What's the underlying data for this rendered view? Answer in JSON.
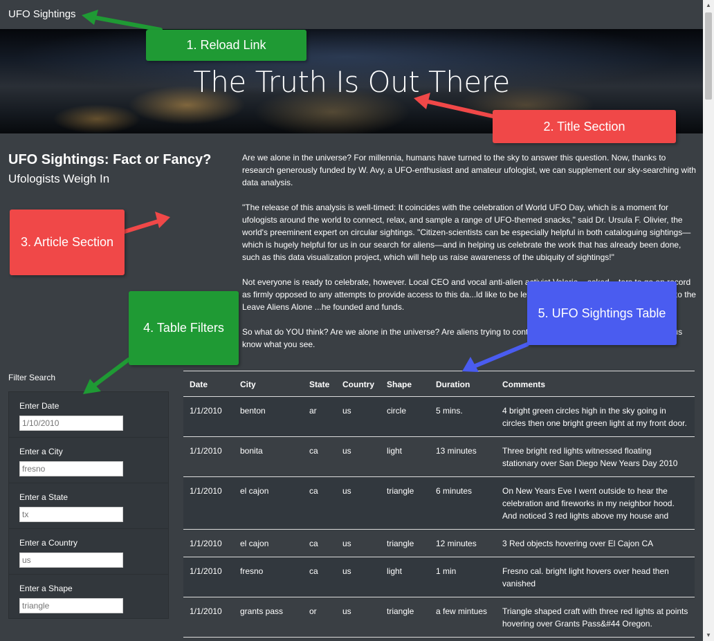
{
  "navbar": {
    "brand": "UFO Sightings"
  },
  "hero": {
    "title": "The Truth Is Out There"
  },
  "article": {
    "title": "UFO Sightings: Fact or Fancy?",
    "subtitle": "Ufologists Weigh In",
    "paragraphs": [
      "Are we alone in the universe? For millennia, humans have turned to the sky to answer this question. Now, thanks to research generously funded by W. Avy, a UFO-enthusiast and amateur ufologist, we can supplement our sky-searching with data analysis.",
      "\"The release of this analysis is well-timed: It coincides with the celebration of World UFO Day, which is a moment for ufologists around the world to connect, relax, and sample a range of UFO-themed snacks,\" said Dr. Ursula F. Olivier, the world's preeminent expert on circular sightings. \"Citizen-scientists can be especially helpful in both cataloguing sightings—which is hugely helpful for us in our search for aliens—and in helping us celebrate the work that has already been done, such as this data visualization project, which will help us raise awareness of the ubiquity of sightings!\"",
      "Not everyone is ready to celebrate, however. Local CEO and vocal anti-alien activist Valerie... asked ...ters to go on record as firmly opposed to any attempts to provide access to this da...ld like to be left alone,\" she stated, before directing us to the Leave Aliens Alone ...he founded and funds.",
      "So what do YOU think? Are we alone in the universe? Are aliens trying to cont...Dig through the data yourself, and let us know what you see."
    ]
  },
  "filters": {
    "title": "Filter Search",
    "items": [
      {
        "label": "Enter Date",
        "placeholder": "1/10/2010"
      },
      {
        "label": "Enter a City",
        "placeholder": "fresno"
      },
      {
        "label": "Enter a State",
        "placeholder": "tx"
      },
      {
        "label": "Enter a Country",
        "placeholder": "us"
      },
      {
        "label": "Enter a Shape",
        "placeholder": "triangle"
      }
    ]
  },
  "table": {
    "headers": [
      "Date",
      "City",
      "State",
      "Country",
      "Shape",
      "Duration",
      "Comments"
    ],
    "rows": [
      [
        "1/1/2010",
        "benton",
        "ar",
        "us",
        "circle",
        "5 mins.",
        "4 bright green circles high in the sky going in circles then one bright green light at my front door."
      ],
      [
        "1/1/2010",
        "bonita",
        "ca",
        "us",
        "light",
        "13 minutes",
        "Three bright red lights witnessed floating stationary over San Diego New Years Day 2010"
      ],
      [
        "1/1/2010",
        "el cajon",
        "ca",
        "us",
        "triangle",
        "6 minutes",
        "On New Years Eve I went outside to hear the celebration and fireworks in my neighbor hood. And noticed 3 red lights above my house and"
      ],
      [
        "1/1/2010",
        "el cajon",
        "ca",
        "us",
        "triangle",
        "12 minutes",
        "3 Red objects hovering over El Cajon CA"
      ],
      [
        "1/1/2010",
        "fresno",
        "ca",
        "us",
        "light",
        "1 min",
        "Fresno cal. bright light hovers over head then vanished"
      ],
      [
        "1/1/2010",
        "grants pass",
        "or",
        "us",
        "triangle",
        "a few mintues",
        "Triangle shaped craft with three red lights at points hovering over Grants Pass&#44 Oregon."
      ]
    ]
  },
  "annotations": {
    "a1": "1. Reload Link",
    "a2": "2. Title Section",
    "a3": "3. Article Section",
    "a4": "4. Table Filters",
    "a5": "5. UFO Sightings Table"
  },
  "colors": {
    "background": "#3a3f44",
    "green": "#1f9a34",
    "red": "#f04848",
    "blue": "#4a5cf0"
  }
}
